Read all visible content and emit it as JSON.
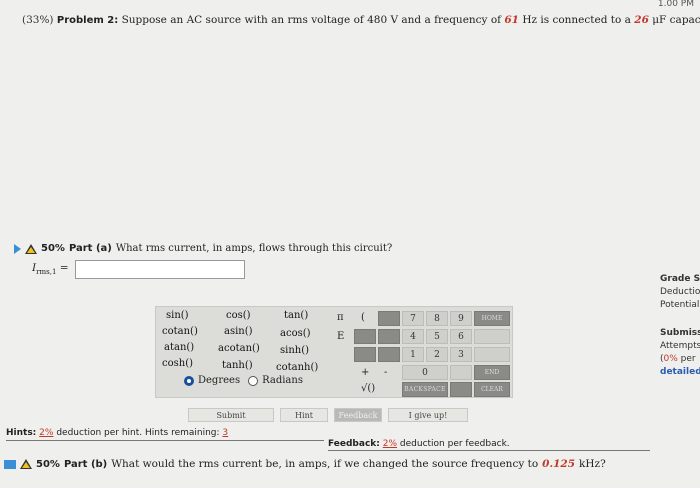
{
  "topbar": {
    "clock": "1.00 PM"
  },
  "problem": {
    "percent": "(33%)",
    "label": "Problem 2:",
    "text_before_v": "Suppose an AC source with an rms voltage of 480 V and a frequency of",
    "frequency": "61",
    "text_mid": "Hz is connected to a",
    "capacitance": "26",
    "text_after": "μF capacitor."
  },
  "part_a": {
    "percent": "50%",
    "label": "Part (a)",
    "question": "What rms current, in amps, flows through this circuit?",
    "answer_label": "I",
    "answer_sub": "rms,1",
    "answer_eq": " =",
    "answer_value": ""
  },
  "calculator": {
    "functions": [
      "sin()",
      "cos()",
      "tan()",
      "cotan()",
      "asin()",
      "acos()",
      "atan()",
      "acotan()",
      "sinh()",
      "cosh()",
      "tanh()",
      "cotanh()"
    ],
    "degrees_label": "Degrees",
    "radians_label": "Radians",
    "symbols": {
      "pi": "π",
      "paren_open": "(",
      "e": "E",
      "plus": "+",
      "minus": "-",
      "sqrt": "√()"
    },
    "digits": [
      "7",
      "8",
      "9",
      "4",
      "5",
      "6",
      "1",
      "2",
      "3",
      "0"
    ],
    "home": "HOME",
    "end": "END",
    "backspace": "BACKSPACE",
    "clear": "CLEAR"
  },
  "actions": {
    "submit": "Submit",
    "hint": "Hint",
    "feedback": "Feedback",
    "give_up": "I give up!"
  },
  "hints": {
    "label": "Hints:",
    "deduction": "2%",
    "text": "deduction per hint. Hints remaining:",
    "remaining": "3"
  },
  "feedback": {
    "label": "Feedback:",
    "deduction": "2%",
    "text": "deduction per feedback."
  },
  "part_b": {
    "percent": "50%",
    "label": "Part (b)",
    "question": "What would the rms current be, in amps, if we changed the source frequency to",
    "value": "0.125",
    "unit": "kHz?"
  },
  "sidebar": {
    "grade": "Grade S",
    "deduction": "Deductio",
    "potential": "Potential",
    "submissions": "Submissi",
    "attempts": "Attempts",
    "per_prefix": "(",
    "per_pct": "0%",
    "per_suffix": " per",
    "detailed": "detailed"
  }
}
